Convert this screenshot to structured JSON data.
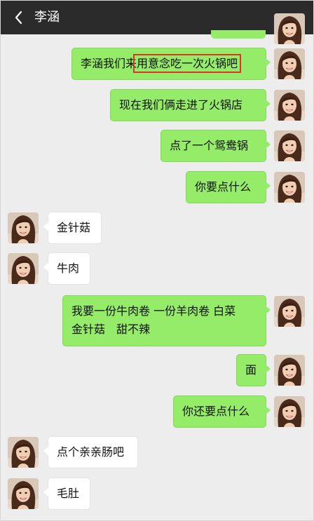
{
  "header": {
    "title": "李涵",
    "back_icon": "chevron-left-icon",
    "more_icon": "more-dots-icon"
  },
  "colors": {
    "header_bg": "#2b2b2b",
    "chat_bg": "#ededed",
    "my_bubble": "#95ec69",
    "their_bubble": "#ffffff",
    "highlight": "#e0312b"
  },
  "messages": [
    {
      "from": "me",
      "text_before": "李涵我们来",
      "text_highlight": "用意念吃一次火锅吧"
    },
    {
      "from": "me",
      "text": "现在我们俩走进了火锅店"
    },
    {
      "from": "me",
      "text": "点了一个鸳鸯锅"
    },
    {
      "from": "me",
      "text": "你要点什么"
    },
    {
      "from": "them",
      "text": "金针菇"
    },
    {
      "from": "them",
      "text": "牛肉"
    },
    {
      "from": "me",
      "line1": "我要一份牛肉卷 一份羊肉卷 白菜",
      "line2": "金针菇　甜不辣"
    },
    {
      "from": "me",
      "text": "面"
    },
    {
      "from": "me",
      "text": "你还要点什么"
    },
    {
      "from": "them",
      "text": "点个亲亲肠吧"
    },
    {
      "from": "them",
      "text": "毛肚"
    }
  ]
}
